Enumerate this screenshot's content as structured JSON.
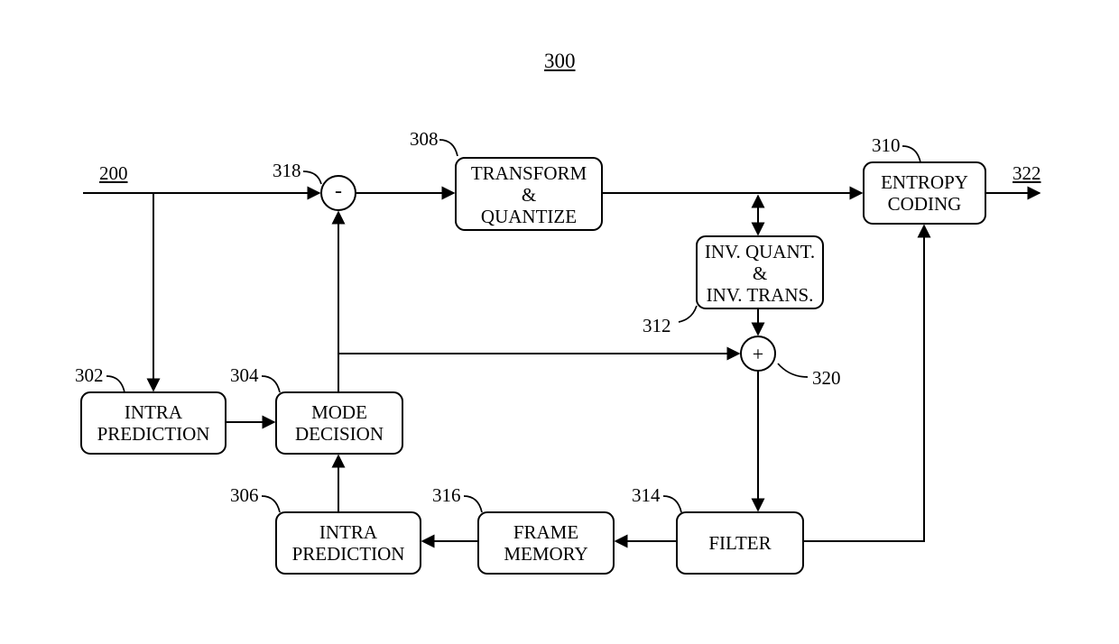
{
  "figure_number": "300",
  "input_ref": "200",
  "output_ref": "322",
  "blocks": {
    "intra_prediction_1": {
      "label": "INTRA\nPREDICTION",
      "ref": "302"
    },
    "mode_decision": {
      "label": "MODE\nDECISION",
      "ref": "304"
    },
    "intra_prediction_2": {
      "label": "INTRA\nPREDICTION",
      "ref": "306"
    },
    "transform_quantize": {
      "label": "TRANSFORM\n&\nQUANTIZE",
      "ref": "308"
    },
    "entropy_coding": {
      "label": "ENTROPY\nCODING",
      "ref": "310"
    },
    "inv_quant_trans": {
      "label": "INV. QUANT.\n&\nINV. TRANS.",
      "ref": "312"
    },
    "filter": {
      "label": "FILTER",
      "ref": "314"
    },
    "frame_memory": {
      "label": "FRAME\nMEMORY",
      "ref": "316"
    }
  },
  "summers": {
    "subtract": {
      "sign": "-",
      "ref": "318"
    },
    "add": {
      "sign": "+",
      "ref": "320"
    }
  }
}
